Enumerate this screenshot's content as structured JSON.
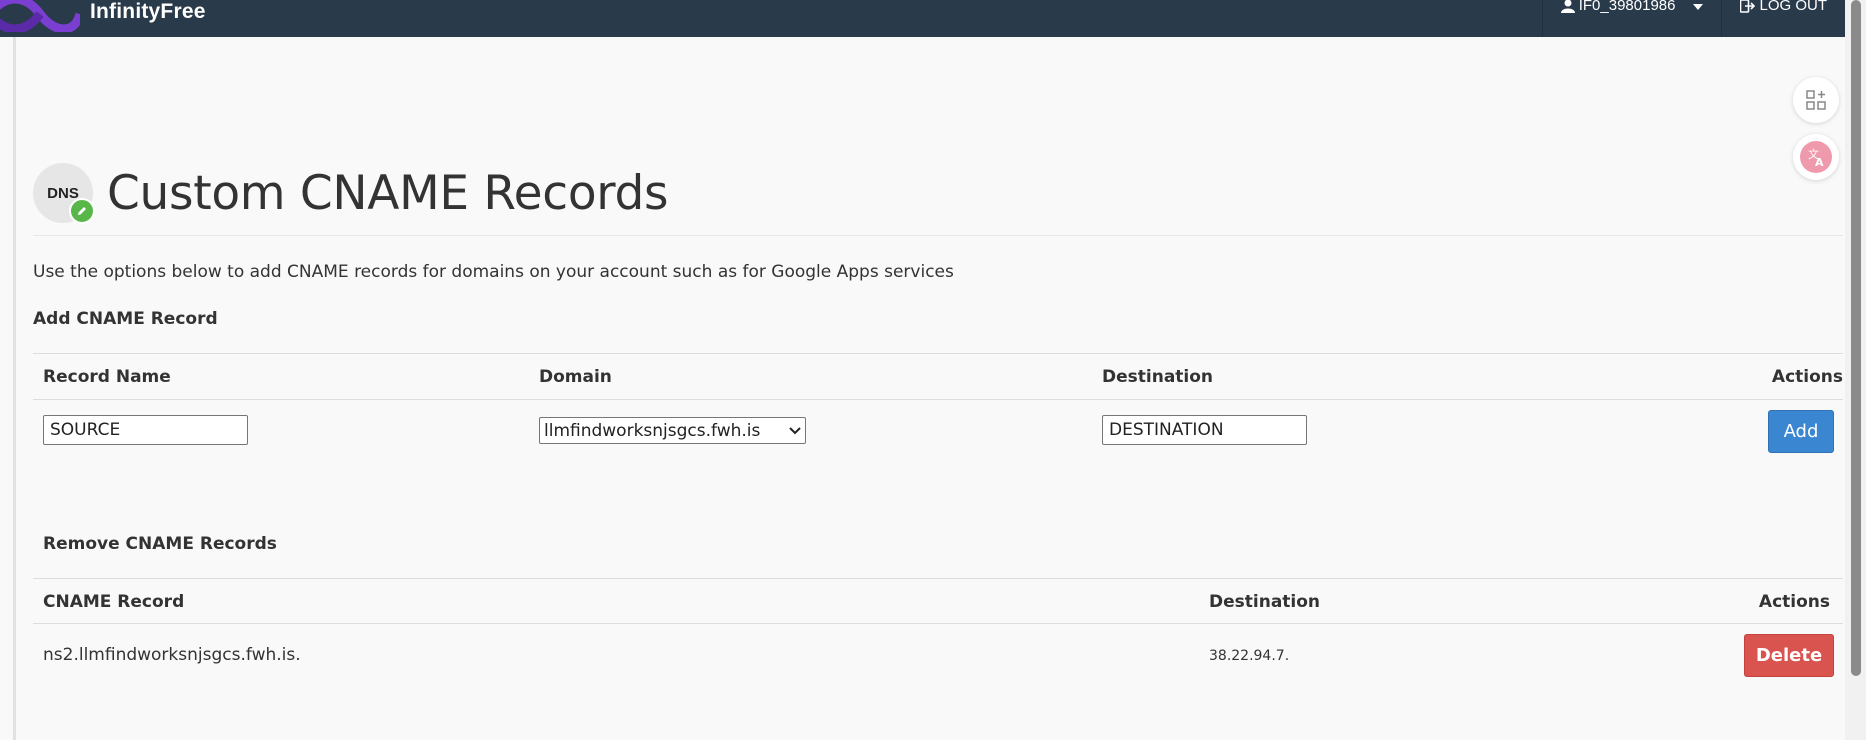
{
  "topbar": {
    "brand": "InfinityFree",
    "username": "IF0_39801986",
    "logout_label": "LOG OUT"
  },
  "page": {
    "title": "Custom CNAME Records",
    "badge": "DNS",
    "intro": "Use the options below to add CNAME records for domains on your account such as for Google Apps services"
  },
  "add_section": {
    "title": "Add CNAME Record",
    "headers": [
      "Record Name",
      "Domain",
      "Destination",
      "Actions"
    ],
    "record_name_value": "SOURCE",
    "domain_selected": "llmfindworksnjsgcs.fwh.is",
    "destination_value": "DESTINATION",
    "add_label": "Add"
  },
  "remove_section": {
    "title": "Remove CNAME Records",
    "headers": [
      "CNAME Record",
      "Destination",
      "Actions"
    ],
    "rows": [
      {
        "record": "ns2.llmfindworksnjsgcs.fwh.is.",
        "destination": "38.22.94.7.",
        "delete_label": "Delete"
      }
    ]
  },
  "colors": {
    "topbar": "#293a4a",
    "primary": "#3a86d1",
    "danger": "#d9534f",
    "brand_purple": "#7a3fd1"
  },
  "icons": [
    "user-icon",
    "logout-icon",
    "apps-icon",
    "translate-icon",
    "edit-icon",
    "infinity-logo"
  ]
}
